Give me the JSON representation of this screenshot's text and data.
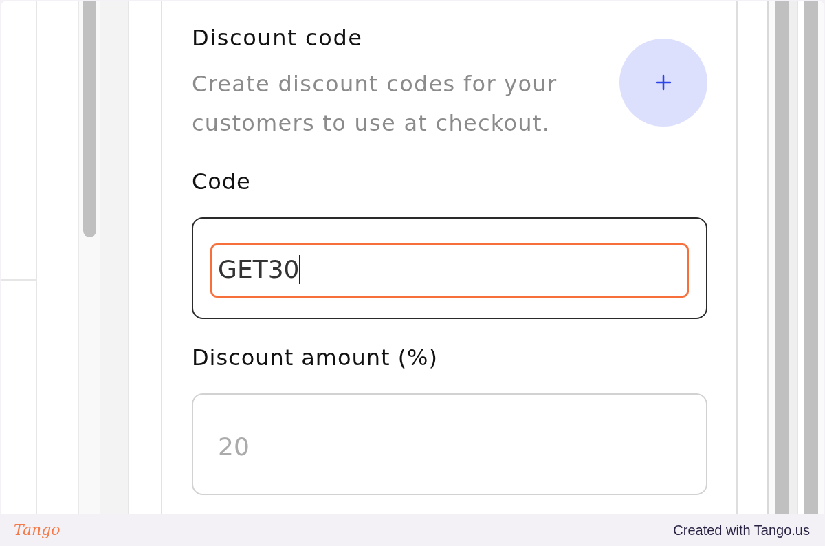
{
  "form": {
    "title": "Discount code",
    "description": "Create discount codes for your customers to use at checkout.",
    "fields": [
      {
        "kind": "text",
        "label": "Code",
        "value": "GET30",
        "focused": true,
        "highlighted": true
      },
      {
        "kind": "text",
        "label": "Discount amount (%)",
        "placeholder": "20",
        "focused": false,
        "highlighted": false
      }
    ]
  },
  "footer": {
    "logo": "Tango",
    "credit": "Created with Tango.us"
  }
}
